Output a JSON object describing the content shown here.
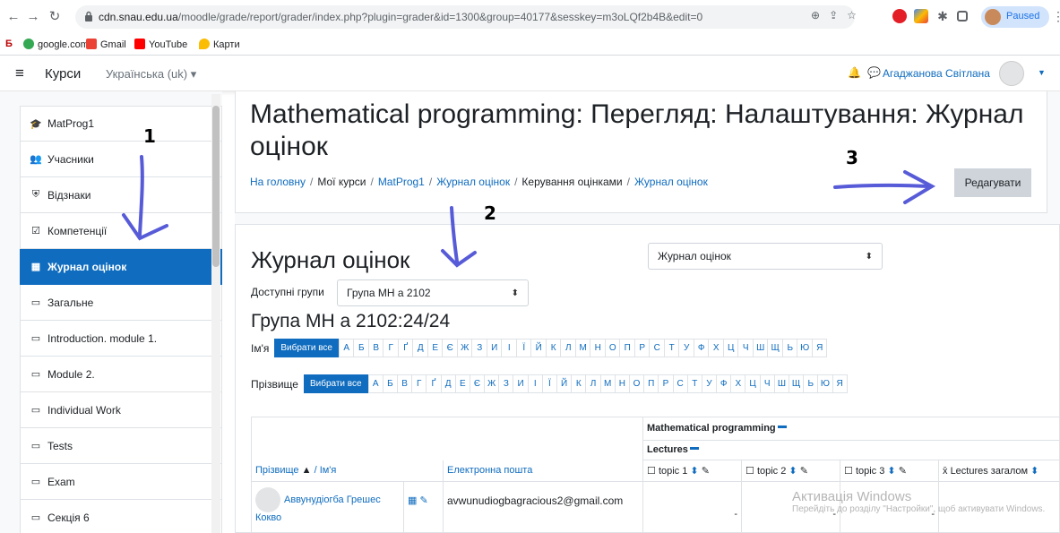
{
  "browser": {
    "url_host": "cdn.snau.edu.ua",
    "url_path": "/moodle/grade/report/grader/index.php?plugin=grader&id=1300&group=40177&sesskey=m3oLQf2b4B&edit=0",
    "profile_status": "Paused",
    "bookmarks": [
      {
        "label": "google.com",
        "icon": "google-favicon",
        "color": "#34a853"
      },
      {
        "label": "Gmail",
        "icon": "gmail-icon",
        "color": "#ea4335"
      },
      {
        "label": "YouTube",
        "icon": "youtube-icon",
        "color": "#ff0000"
      },
      {
        "label": "Карти",
        "icon": "maps-pin-icon",
        "color": "#fbbc04"
      }
    ]
  },
  "navbar": {
    "brand": "Курси",
    "language": "Українська (uk) ▾",
    "user_name": "Агаджанова Світлана"
  },
  "sidebar": {
    "items": [
      {
        "label": "MatProg1",
        "icon": "graduation-cap-icon",
        "glyph": "🎓"
      },
      {
        "label": "Учасники",
        "icon": "users-icon",
        "glyph": "👥"
      },
      {
        "label": "Відзнаки",
        "icon": "shield-icon",
        "glyph": "⛨"
      },
      {
        "label": "Компетенції",
        "icon": "checkbox-icon",
        "glyph": "☑"
      },
      {
        "label": "Журнал оцінок",
        "icon": "table-icon",
        "glyph": "▦",
        "active": true
      },
      {
        "label": "Загальне",
        "icon": "folder-icon",
        "glyph": "▭"
      },
      {
        "label": "Introduction. module 1.",
        "icon": "folder-icon",
        "glyph": "▭"
      },
      {
        "label": "Module 2.",
        "icon": "folder-icon",
        "glyph": "▭"
      },
      {
        "label": "Individual Work",
        "icon": "folder-icon",
        "glyph": "▭"
      },
      {
        "label": "Tests",
        "icon": "folder-icon",
        "glyph": "▭"
      },
      {
        "label": "Exam",
        "icon": "folder-icon",
        "glyph": "▭"
      },
      {
        "label": "Секція 6",
        "icon": "folder-icon",
        "glyph": "▭"
      }
    ]
  },
  "header": {
    "title": "Mathematical programming: Перегляд: Налаштування: Журнал оцінок",
    "breadcrumb": [
      "На головну",
      "Мої курси",
      "MatProg1",
      "Журнал оцінок",
      "Керування оцінками",
      "Журнал оцінок"
    ],
    "edit_button": "Редагувати"
  },
  "content": {
    "heading": "Журнал оцінок",
    "report_select": "Журнал оцінок",
    "groups_label": "Доступні групи",
    "group_select": "Група МН а 2102",
    "group_heading": "Група МН а 2102:24/24",
    "first_name_label": "Ім'я",
    "last_name_label": "Прізвище",
    "select_all": "Вибрати все",
    "letters": [
      "А",
      "Б",
      "В",
      "Г",
      "Ґ",
      "Д",
      "Е",
      "Є",
      "Ж",
      "З",
      "И",
      "І",
      "Ї",
      "Й",
      "К",
      "Л",
      "М",
      "Н",
      "О",
      "П",
      "Р",
      "С",
      "Т",
      "У",
      "Ф",
      "Х",
      "Ц",
      "Ч",
      "Ш",
      "Щ",
      "Ь",
      "Ю",
      "Я"
    ]
  },
  "table": {
    "category_course": "Mathematical programming",
    "category_lectures": "Lectures",
    "col_surname": "Прізвище",
    "col_firstname": "Ім'я",
    "col_email": "Електронна пошта",
    "col_topic1": "topic 1",
    "col_topic2": "topic 2",
    "col_topic3": "topic 3",
    "col_total": "Lectures загалом",
    "row1_name": "Аввунудіогба Грешес Кокво",
    "row1_email": "avwunudiogbagracious2@gmail.com",
    "dash": "-"
  },
  "annotations": {
    "n1": "1",
    "n2": "2",
    "n3": "3"
  },
  "watermark": {
    "title": "Активація Windows",
    "subtitle": "Перейдіть до розділу \"Настройки\", щоб активувати Windows."
  },
  "colors": {
    "primary": "#0f6cbf",
    "annotation_arrow": "#3a3fd1"
  }
}
